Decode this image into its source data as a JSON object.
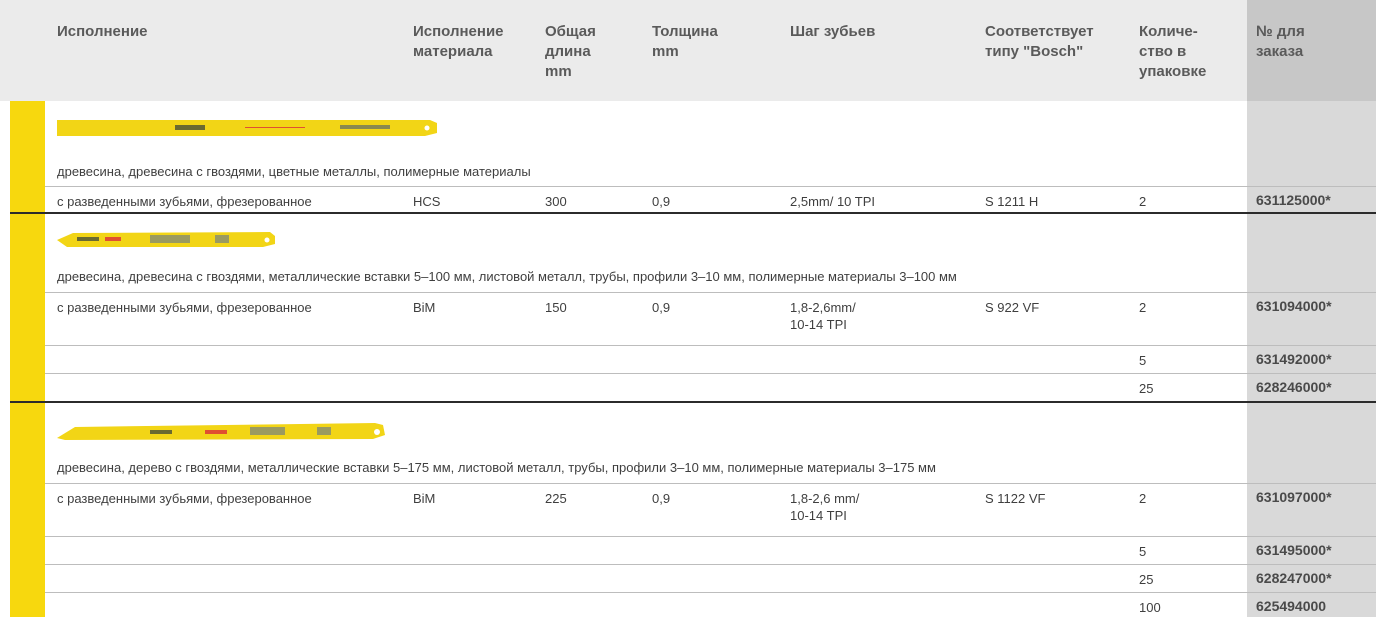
{
  "headers": {
    "execution": "Исполнение",
    "material": "Исполнение\nматериала",
    "length": "Общая\nдлина\nmm",
    "thickness": "Толщина\nmm",
    "pitch": "Шаг зубьев",
    "bosch": "Соответствует\nтипу \"Bosch\"",
    "quantity": "Количе-\nство в\nупаковке",
    "order": "№ для\nзаказа"
  },
  "colors": {
    "accent_yellow": "#f7d80e",
    "order_column": "#d9d9d9",
    "header_bg": "#ebebeb"
  },
  "products": [
    {
      "application": "древесина, древесина с гвоздями, цветные металлы, полимерные материалы",
      "execution": "с разведенными зубьями, фрезерованное",
      "material": "HCS",
      "length": "300",
      "thickness": "0,9",
      "pitch": "2,5mm/ 10 TPI",
      "bosch": "S 1211 H",
      "rows": [
        {
          "quantity": "2",
          "order": "631125000*"
        }
      ]
    },
    {
      "application": "древесина, древесина с гвоздями, металлические вставки    5–100 мм, листовой металл, трубы, профили 3–10 мм, полимерные материалы 3–100 мм",
      "execution": "с разведенными зубьями, фрезерованное",
      "material": "BiM",
      "length": "150",
      "thickness": "0,9",
      "pitch": "1,8-2,6mm/\n10-14 TPI",
      "bosch": "S 922 VF",
      "rows": [
        {
          "quantity": "2",
          "order": "631094000*"
        },
        {
          "quantity": "5",
          "order": "631492000*"
        },
        {
          "quantity": "25",
          "order": "628246000*"
        }
      ]
    },
    {
      "application": "древесина, дерево с гвоздями, металлические вставки    5–175 мм, листовой металл, трубы, профили 3–10 мм, полимерные материалы 3–175 мм",
      "execution": "с разведенными зубьями, фрезерованное",
      "material": "BiM",
      "length": "225",
      "thickness": "0,9",
      "pitch": "1,8-2,6 mm/\n10-14 TPI",
      "bosch": "S 1122 VF",
      "rows": [
        {
          "quantity": "2",
          "order": "631097000*"
        },
        {
          "quantity": "5",
          "order": "631495000*"
        },
        {
          "quantity": "25",
          "order": "628247000*"
        },
        {
          "quantity": "100",
          "order": "625494000"
        }
      ]
    }
  ]
}
